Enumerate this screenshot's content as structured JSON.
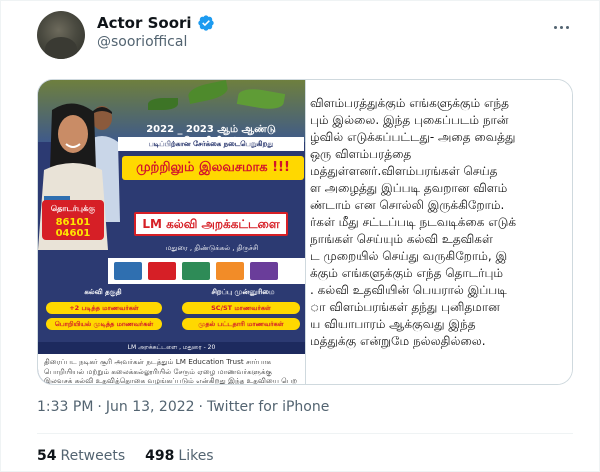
{
  "author": {
    "display_name": "Actor Soori",
    "handle": "@soorioffical",
    "verified": true,
    "verified_color": "#1d9bf0"
  },
  "poster": {
    "year_line": "2022 _ 2023 ஆம் ஆண்டு பொறியியல்",
    "sub_line": "படிப்பிற்கான சேர்க்கை நடைபெறுகிறது",
    "free_banner": "முற்றிலும் இலவசமாக !!!",
    "contact_label": "தொடர்புக்கு",
    "contact_phone": "86101 04601",
    "trust_name": "LM கல்வி அறக்கட்டளை",
    "locations": "மதுரை , திண்டுக்கல் , திருச்சி",
    "col_left_header": "கல்வி தகுதி",
    "col_right_header": "சிறப்பு முன்னுரிமை",
    "pill_1": "+2 படித்த மாணவர்கள்",
    "pill_2": "பொறியியல் முடித்த மாணவர்கள்",
    "pill_3": "SC/ST மாணவர்கள்",
    "pill_4": "முதல் பட்டதாரி மாணவர்கள்",
    "footer_strip": "LM அறக்கட்டளை , மதுரை - 20",
    "caption": "திரைப்பட நடிகர் சூரி அவர்கள் நடத்தும் LM Education Trust சார்பாக பொறியியல் மற்றும் கலைக்கல்லூரியில் சேரும் ஏழை மாணவர்களுக்கு இலவசக் கல்வி உதவித்தொகை வழங்கப்படும் என்கிறது இந்த உதவியை பெற விரும்பும்",
    "colors": {
      "navy": "#2c3a72",
      "yellow": "#ffd800",
      "red": "#d61f26"
    }
  },
  "statement_lines": [
    "விளம்பரத்துக்கும் எங்களுக்கும் எந்த",
    "பும் இல்லை. இந்த புகைப்படம் நான்",
    "ழ்வில் எடுக்கப்பட்டது- அதை வைத்து",
    "ஒரு விளம்பரத்தை",
    "மத்துள்ளனர்.விளம்பரங்கள் செய்த",
    "ள அழைத்து இப்படி தவறான விளம்",
    "ண்டாம் என சொல்லி இருக்கிறோம்.",
    "ர்கள் மீது சட்டப்படி நடவடிக்கை எடுக்",
    "நாங்கள் செய்யும் கல்வி உதவிகள்",
    "ட முறையில் செய்து வருகிறோம், இ",
    "க்கும் எங்களுக்கும் எந்த தொடர்பும்",
    ". கல்வி உதவியின் பெயரால் இப்படி",
    "ா விளம்பரங்கள் தந்து புனிதமான",
    "ய வியாபாரம் ஆக்குவது இந்த",
    "மத்துக்கு என்றுமே நல்லதில்லை."
  ],
  "meta": {
    "time": "1:33 PM",
    "separator": "·",
    "date": "Jun 13, 2022",
    "source": "Twitter for iPhone"
  },
  "stats": {
    "retweets_count": "54",
    "retweets_label": "Retweets",
    "likes_count": "498",
    "likes_label": "Likes"
  }
}
